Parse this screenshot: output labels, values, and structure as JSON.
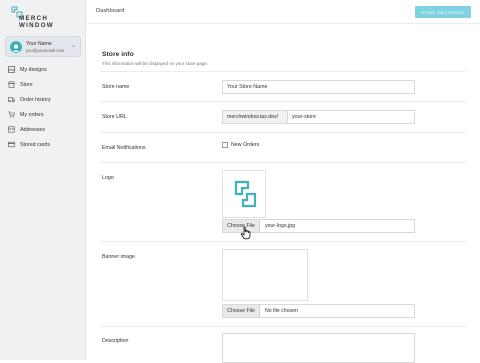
{
  "brand": {
    "line1": "MERCH",
    "line2": "WINDOW",
    "accent": "#3fb2bc"
  },
  "user": {
    "name": "Your Name",
    "email": "you@youremail.com"
  },
  "sidebar": {
    "items": [
      {
        "label": "My designs",
        "icon": "designs-icon"
      },
      {
        "label": "Store",
        "icon": "store-icon"
      },
      {
        "label": "Order history",
        "icon": "truck-icon"
      },
      {
        "label": "My orders",
        "icon": "cart-icon"
      },
      {
        "label": "Addresses",
        "icon": "address-icon"
      },
      {
        "label": "Stored cards",
        "icon": "card-icon"
      }
    ]
  },
  "header": {
    "title": "Dashboard",
    "cta": "START DESIGNING",
    "cta_color": "#7fd3e0"
  },
  "store_info": {
    "title": "Store info",
    "subtitle": "This information will be displayed on your store page.",
    "store_name": {
      "label": "Store name",
      "value": "Your Store Name"
    },
    "store_url": {
      "label": "Store URL",
      "prefix": "merchwindow.tas.dev/",
      "value": "your-store"
    },
    "notifications": {
      "label": "Email Notifications",
      "option": "New Orders",
      "checked": false
    },
    "logo": {
      "label": "Logo",
      "button": "Choose File",
      "file": "your-logo.jpg"
    },
    "banner": {
      "label": "Banner image",
      "button": "Choose File",
      "file": "No file chosen"
    },
    "description": {
      "label": "Description",
      "value": ""
    }
  }
}
